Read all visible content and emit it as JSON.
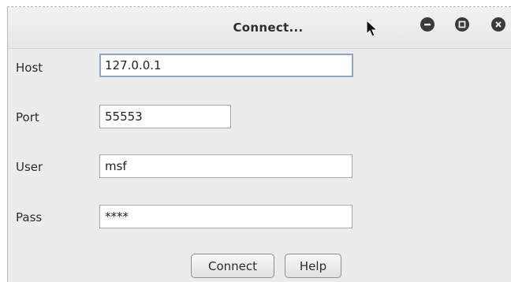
{
  "window": {
    "title": "Connect..."
  },
  "window_controls": {
    "minimize_icon": "minus-circle-icon",
    "maximize_icon": "square-circle-icon",
    "close_icon": "x-circle-icon"
  },
  "form": {
    "host": {
      "label": "Host",
      "value": "127.0.0.1"
    },
    "port": {
      "label": "Port",
      "value": "55553"
    },
    "user": {
      "label": "User",
      "value": "msf"
    },
    "pass": {
      "label": "Pass",
      "value": "****"
    }
  },
  "buttons": {
    "connect_label": "Connect",
    "help_label": "Help"
  },
  "colors": {
    "window_bg": "#ececec",
    "focus_border": "#8fa6c8",
    "control_dark": "#3a3a3a"
  }
}
